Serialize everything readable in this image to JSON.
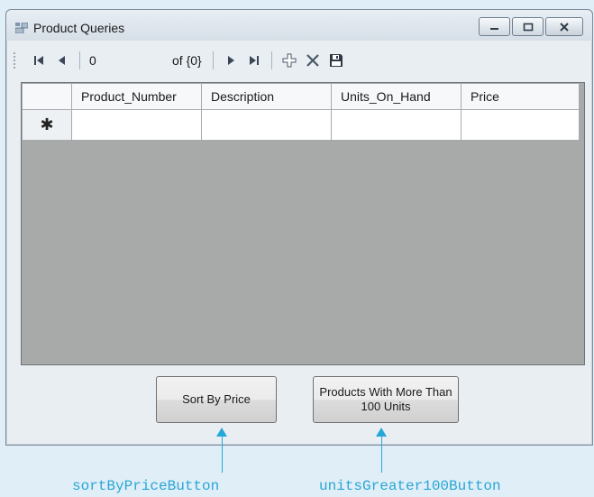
{
  "window": {
    "title": "Product Queries"
  },
  "toolbar": {
    "position_value": "0",
    "count_label": "of {0}"
  },
  "grid": {
    "columns": [
      "Product_Number",
      "Description",
      "Units_On_Hand",
      "Price"
    ],
    "new_row_marker": "✱"
  },
  "buttons": {
    "sort_by_price": "Sort By Price",
    "units_greater_100": "Products With More Than 100 Units"
  },
  "captions": {
    "sort_button_name": "sortByPriceButton",
    "units_button_name": "unitsGreater100Button"
  },
  "colors": {
    "annotation": "#25a8d8",
    "grid_background": "#a8a9a9"
  }
}
